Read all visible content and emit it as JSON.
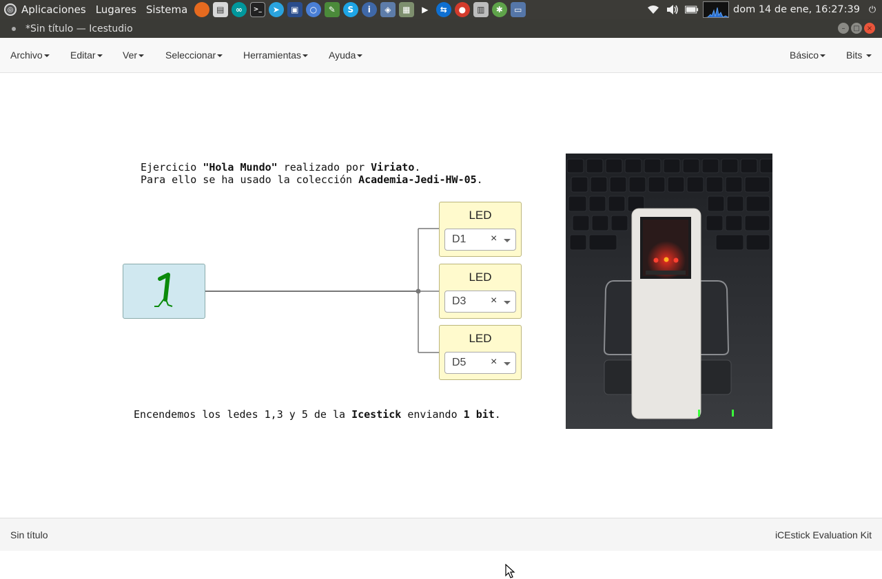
{
  "system_panel": {
    "menus": [
      "Aplicaciones",
      "Lugares",
      "Sistema"
    ],
    "clock": "dom 14 de ene, 16:27:39",
    "launchers": [
      "firefox-icon",
      "files-icon",
      "arduino-icon",
      "terminal-icon",
      "telegram-icon",
      "monitor-icon",
      "chromium-icon",
      "editor-icon",
      "skype-icon",
      "info-icon",
      "virtualbox-icon",
      "calculator-icon",
      "media-icon",
      "teamviewer-icon",
      "chrome-icon",
      "calc-icon",
      "network-icon",
      "desktop-icon"
    ]
  },
  "window": {
    "title": "*Sin título — Icestudio"
  },
  "menubar": {
    "archivo": "Archivo",
    "editar": "Editar",
    "ver": "Ver",
    "seleccionar": "Seleccionar",
    "herramientas": "Herramientas",
    "ayuda": "Ayuda",
    "basico": "Básico",
    "bits": "Bits"
  },
  "canvas": {
    "note_top": {
      "l1_a": "Ejercicio ",
      "l1_b": "\"Hola Mundo\"",
      "l1_c": " realizado por ",
      "l1_d": "Viriato",
      "l1_e": ".",
      "l2_a": "Para ello se ha usado la colección ",
      "l2_b": "Academia-Jedi-HW-05",
      "l2_c": "."
    },
    "note_bottom": {
      "a": "Encendemos los ledes 1,3 y 5 de la ",
      "b": "Icestick",
      "c": " enviando ",
      "d": "1 bit",
      "e": "."
    },
    "const_block": {
      "value": "1"
    },
    "leds": [
      {
        "title": "LED",
        "pin": "D1"
      },
      {
        "title": "LED",
        "pin": "D3"
      },
      {
        "title": "LED",
        "pin": "D5"
      }
    ]
  },
  "statusbar": {
    "left": "Sin título",
    "right": "iCEstick Evaluation Kit"
  },
  "colors": {
    "panel": "#3c3b37",
    "const_block": "#d0e8f0",
    "led_block": "#fffacd",
    "wire": "#777777",
    "bit_glyph": "#0a8a0a"
  }
}
